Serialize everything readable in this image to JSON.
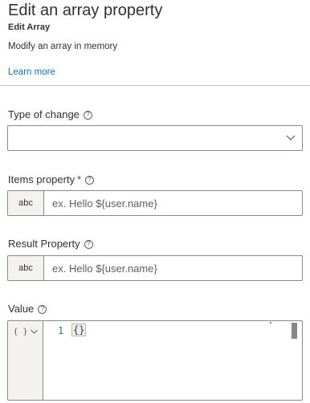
{
  "header": {
    "title": "Edit an array property",
    "subtitle": "Edit Array",
    "description": "Modify an array in memory",
    "learn_more": "Learn more"
  },
  "fields": {
    "type_of_change": {
      "label": "Type of change",
      "value": ""
    },
    "items_property": {
      "label": "Items property",
      "required_mark": "*",
      "prefix": "abc",
      "placeholder": "ex. Hello ${user.name}"
    },
    "result_property": {
      "label": "Result Property",
      "prefix": "abc",
      "placeholder": "ex. Hello ${user.name}"
    },
    "value": {
      "label": "Value",
      "type_toggle": "{ }",
      "line_number": "1",
      "code": "{}"
    }
  },
  "icons": {
    "help": "help-circle-icon",
    "chevron": "chevron-down-icon"
  },
  "colors": {
    "link": "#0078d4",
    "required": "#a4262c",
    "border": "#8a8886",
    "prefix_bg": "#f3f2f1"
  }
}
